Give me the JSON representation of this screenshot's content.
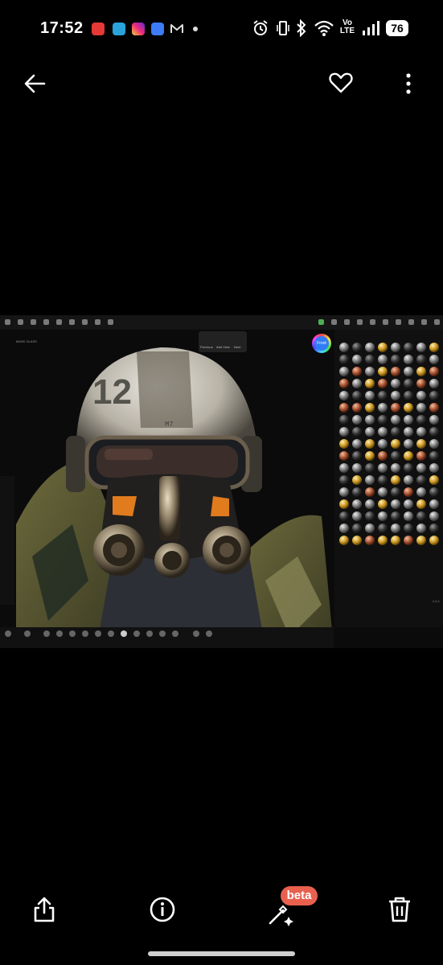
{
  "status_bar": {
    "time": "17:52",
    "network": "Vo LTE",
    "battery": "76",
    "notification_icons": [
      "app-red-icon",
      "telegram-icon",
      "instagram-icon",
      "app-blue-icon",
      "gmail-icon"
    ],
    "system_icons": [
      "alarm-icon",
      "vibrate-icon",
      "bluetooth-icon",
      "wifi-icon",
      "signal-icon",
      "battery-icon"
    ]
  },
  "app_bar": {
    "back_icon": "arrow-left-icon",
    "favorite_icon": "heart-outline-icon",
    "more_icon": "more-vertical-icon"
  },
  "photo": {
    "app_info": [
      "3D sculpting app screenshot"
    ],
    "mask_label": "MASK GLASS",
    "front_button": "Front",
    "nav": [
      "Previous",
      "Add View",
      "Next"
    ],
    "helmet_number": "12",
    "helmet_marking": "M7",
    "version": "2.4.1"
  },
  "bottom_actions": {
    "share_icon": "share-icon",
    "info_icon": "info-icon",
    "edit_icon": "magic-edit-icon",
    "edit_badge": "beta",
    "delete_icon": "trash-icon"
  },
  "colors": {
    "background": "#000000",
    "beta_badge": "#e9604f",
    "front_button": "#2f7cf6"
  }
}
